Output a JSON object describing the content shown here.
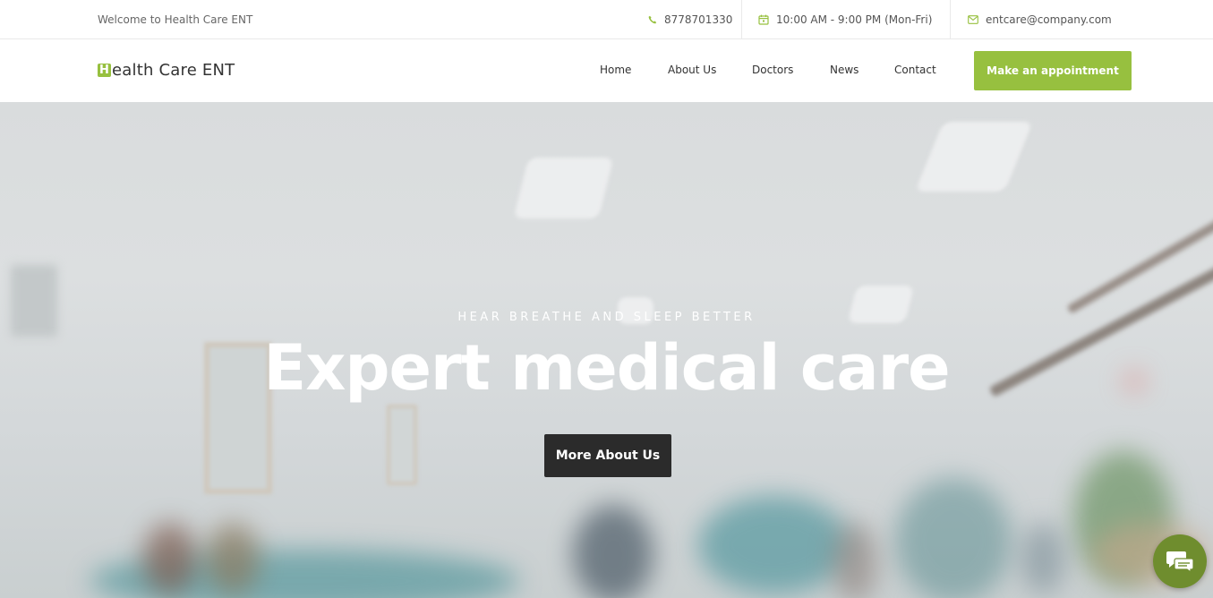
{
  "topbar": {
    "welcome": "Welcome to Health Care ENT",
    "phone": "8778701330",
    "hours": "10:00 AM - 9:00 PM (Mon-Fri)",
    "email": "entcare@company.com"
  },
  "header": {
    "logo_letter": "H",
    "logo_rest": "ealth Care ENT",
    "nav": {
      "home": "Home",
      "about": "About Us",
      "doctors": "Doctors",
      "news": "News",
      "contact": "Contact"
    },
    "cta": "Make an appointment"
  },
  "hero": {
    "tagline": "HEAR BREATHE AND SLEEP BETTER",
    "headline": "Expert medical care",
    "button": "More About Us"
  },
  "icons": {
    "phone": "phone-icon",
    "calendar": "calendar-icon",
    "email": "envelope-icon",
    "chat": "chat-icon"
  },
  "colors": {
    "accent": "#97c03f",
    "chat": "#6f8d2e",
    "dark_button": "#2b2b2b"
  }
}
